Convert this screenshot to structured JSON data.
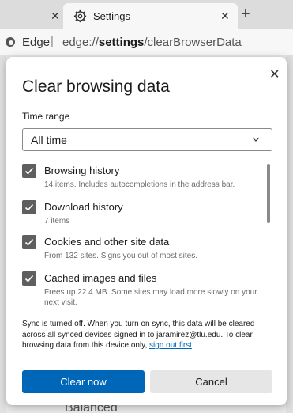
{
  "browser": {
    "active_tab_title": "Settings",
    "edge_label": "Edge",
    "url_prefix": "edge://",
    "url_bold": "settings",
    "url_suffix": "/clearBrowserData"
  },
  "background": {
    "partial_text": "Balanced"
  },
  "dialog": {
    "title": "Clear browsing data",
    "time_range_label": "Time range",
    "time_range_value": "All time",
    "items": [
      {
        "title": "Browsing history",
        "desc": "14 items. Includes autocompletions in the address bar.",
        "checked": true
      },
      {
        "title": "Download history",
        "desc": "7 items",
        "checked": true
      },
      {
        "title": "Cookies and other site data",
        "desc": "From 132 sites. Signs you out of most sites.",
        "checked": true
      },
      {
        "title": "Cached images and files",
        "desc": "Frees up 22.4 MB. Some sites may load more slowly on your next visit.",
        "checked": true
      }
    ],
    "sync_note_text": "Sync is turned off. When you turn on sync, this data will be cleared across all synced devices signed in to jaramirez@tlu.edu. To clear browsing data from this device only, ",
    "sync_note_link": "sign out first",
    "sync_note_end": ".",
    "clear_button": "Clear now",
    "cancel_button": "Cancel"
  },
  "colors": {
    "accent": "#0067b8",
    "checkbox": "#5f5f5f"
  }
}
